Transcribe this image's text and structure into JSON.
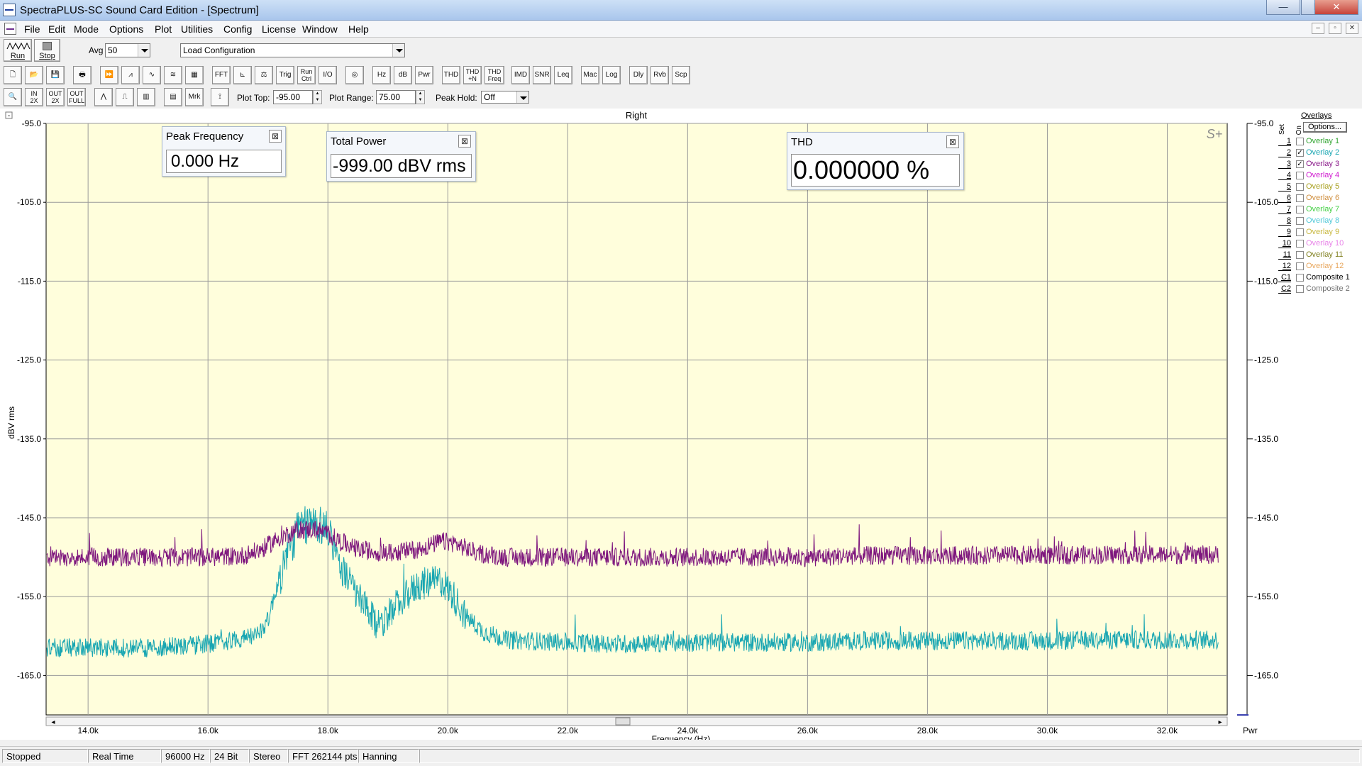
{
  "window": {
    "title": "SpectraPLUS-SC Sound Card Edition - [Spectrum]",
    "minimize": "—",
    "restore": "❐",
    "close": "✕"
  },
  "menu": [
    "File",
    "Edit",
    "Mode",
    "Options",
    "Plot",
    "Utilities",
    "Config",
    "License",
    "Window",
    "Help"
  ],
  "mdi_controls": [
    "–",
    "▫",
    "✕"
  ],
  "toolbar1": {
    "run": "Run",
    "stop": "Stop",
    "avg_label": "Avg",
    "avg_value": "50",
    "config_value": "Load Configuration"
  },
  "toolbar2": {
    "buttons": [
      "FFT",
      "Trig",
      "Run\nCtrl",
      "I/O",
      "Hz",
      "dB",
      "Pwr",
      "THD",
      "THD\n+N",
      "THD\nFreq",
      "IMD",
      "SNR",
      "Leq",
      "Mac",
      "Log",
      "Dly",
      "Rvb",
      "Scp"
    ]
  },
  "toolbar3": {
    "mrk": "Mrk",
    "zoom_buttons": [
      "IN\n2X",
      "OUT\n2X",
      "OUT\nFULL"
    ],
    "plot_top_label": "Plot Top:",
    "plot_top_value": "-95.00",
    "plot_range_label": "Plot Range:",
    "plot_range_value": "75.00",
    "peak_hold_label": "Peak Hold:",
    "peak_hold_value": "Off"
  },
  "chart_header": {
    "channel": "Right",
    "badge": "S+",
    "collapse": "-"
  },
  "panels": {
    "peak_frequency": {
      "title": "Peak Frequency",
      "value": "0.000 Hz"
    },
    "total_power": {
      "title": "Total Power",
      "value": "-999.00 dBV rms"
    },
    "thd": {
      "title": "THD",
      "value": "0.000000 %"
    }
  },
  "overlays": {
    "header": "Overlays",
    "set_label": "Set",
    "on_label": "On",
    "options_button": "Options...",
    "items": [
      {
        "num": "1",
        "name": "Overlay 1",
        "checked": false,
        "color": "#33a533"
      },
      {
        "num": "2",
        "name": "Overlay 2",
        "checked": true,
        "color": "#19a6b2"
      },
      {
        "num": "3",
        "name": "Overlay 3",
        "checked": true,
        "color": "#8c1e8c"
      },
      {
        "num": "4",
        "name": "Overlay 4",
        "checked": false,
        "color": "#d01cd0"
      },
      {
        "num": "5",
        "name": "Overlay 5",
        "checked": false,
        "color": "#a8a020"
      },
      {
        "num": "6",
        "name": "Overlay 6",
        "checked": false,
        "color": "#d09040"
      },
      {
        "num": "7",
        "name": "Overlay 7",
        "checked": false,
        "color": "#44d044"
      },
      {
        "num": "8",
        "name": "Overlay 8",
        "checked": false,
        "color": "#50c8d8"
      },
      {
        "num": "9",
        "name": "Overlay 9",
        "checked": false,
        "color": "#c8b840"
      },
      {
        "num": "10",
        "name": "Overlay 10",
        "checked": false,
        "color": "#e884e8"
      },
      {
        "num": "11",
        "name": "Overlay 11",
        "checked": false,
        "color": "#808020"
      },
      {
        "num": "12",
        "name": "Overlay 12",
        "checked": false,
        "color": "#e8a860"
      },
      {
        "num": "C1",
        "name": "Composite 1",
        "checked": false,
        "color": "#000000"
      },
      {
        "num": "C2",
        "name": "Composite 2",
        "checked": false,
        "color": "#707070"
      }
    ]
  },
  "chart_data": {
    "type": "line",
    "title": "Right",
    "xlabel": "Frequency (Hz)",
    "ylabel": "dBV rms",
    "y_axis_right_label": "Pwr",
    "xlim": [
      13300,
      33000
    ],
    "ylim": [
      -170,
      -95
    ],
    "x_ticks": [
      14000,
      16000,
      18000,
      20000,
      22000,
      24000,
      26000,
      28000,
      30000,
      32000
    ],
    "x_tick_labels": [
      "14.0k",
      "16.0k",
      "18.0k",
      "20.0k",
      "22.0k",
      "24.0k",
      "26.0k",
      "28.0k",
      "30.0k",
      "32.0k"
    ],
    "y_ticks": [
      -95,
      -105,
      -115,
      -125,
      -135,
      -145,
      -155,
      -165
    ],
    "y_tick_labels": [
      "-95.0",
      "-105.0",
      "-115.0",
      "-125.0",
      "-135.0",
      "-145.0",
      "-155.0",
      "-165.0"
    ],
    "grid": true,
    "background": "#fffedc",
    "series": [
      {
        "name": "Overlay 2",
        "color": "#19a6b2",
        "x": [
          13300,
          14000,
          15000,
          16000,
          16800,
          17000,
          17100,
          17300,
          17500,
          17800,
          18000,
          18100,
          18200,
          18500,
          18800,
          19000,
          19300,
          19500,
          19900,
          20100,
          20300,
          20600,
          21000,
          22000,
          23000,
          24000,
          25000,
          26000,
          27000,
          28000,
          29000,
          30000,
          31000,
          32000,
          33000
        ],
        "y": [
          -161.5,
          -161.5,
          -161.5,
          -161.0,
          -160.0,
          -158.0,
          -155.0,
          -150.0,
          -146.5,
          -145.5,
          -146.5,
          -148.0,
          -151.0,
          -155.0,
          -158.5,
          -157.5,
          -155.0,
          -153.5,
          -153.0,
          -155.0,
          -157.5,
          -159.5,
          -160.5,
          -160.8,
          -161.0,
          -160.8,
          -160.8,
          -160.8,
          -160.6,
          -160.6,
          -160.6,
          -160.6,
          -160.5,
          -160.5,
          -160.5
        ]
      },
      {
        "name": "Overlay 3",
        "color": "#7e177e",
        "x": [
          13300,
          14000,
          15000,
          16000,
          16600,
          16900,
          17200,
          17500,
          17800,
          18000,
          18200,
          18500,
          19000,
          19500,
          19900,
          20100,
          20500,
          21000,
          22000,
          23000,
          24000,
          25000,
          26000,
          27000,
          28000,
          29000,
          30000,
          31000,
          32000,
          33000
        ],
        "y": [
          -150.0,
          -150.0,
          -150.0,
          -150.0,
          -149.8,
          -149.0,
          -147.5,
          -146.5,
          -146.5,
          -147.0,
          -148.0,
          -149.0,
          -149.5,
          -149.0,
          -148.0,
          -148.2,
          -149.5,
          -150.0,
          -150.0,
          -150.0,
          -150.0,
          -150.0,
          -150.0,
          -149.8,
          -149.8,
          -149.8,
          -149.7,
          -149.7,
          -149.7,
          -149.7
        ]
      }
    ]
  },
  "status": [
    "Stopped",
    "Real Time",
    "96000 Hz",
    "24 Bit",
    "Stereo",
    "FFT 262144 pts",
    "Hanning"
  ]
}
